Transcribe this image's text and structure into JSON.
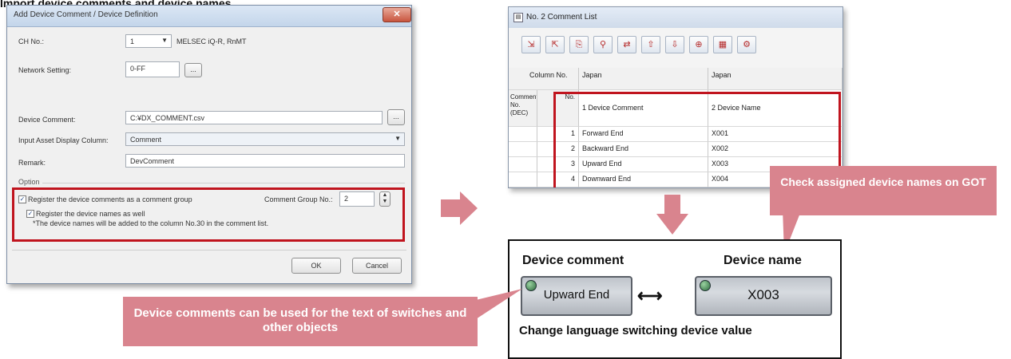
{
  "heading": "Import device comments and device names",
  "dialog": {
    "title": "Add Device Comment / Device Definition",
    "close_glyph": "✕",
    "ch_label": "CH No.:",
    "ch_value": "1",
    "ch_info": "MELSEC iQ-R, RnMT",
    "network_label": "Network Setting:",
    "network_value": "0-FF",
    "network_button": "...",
    "device_comment_label": "Device Comment:",
    "device_comment_value": "C:¥DX_COMMENT.csv",
    "device_comment_button": "...",
    "input_asset_label": "Input Asset Display Column:",
    "input_asset_value": "Comment",
    "remark_label": "Remark:",
    "remark_value": "DevComment",
    "option_label": "Option",
    "register_group_label": "Register the device comments as a comment group",
    "register_group_checked": true,
    "comment_group_label": "Comment Group No.:",
    "comment_group_value": "2",
    "register_names_label": "Register the device names as well",
    "register_names_checked": true,
    "names_note": "*The device names will be added to the column No.30 in the comment list.",
    "ok_label": "OK",
    "cancel_label": "Cancel"
  },
  "comment_list": {
    "title": "No. 2  Comment List",
    "toolbar_icons": [
      "import-icon",
      "export-icon",
      "copy-icon",
      "find-icon",
      "replace-icon",
      "up-icon",
      "down-icon",
      "zoom-icon",
      "table-icon",
      "settings-icon"
    ],
    "column_no_label": "Column No.",
    "col1_lang": "Japan",
    "col2_lang": "Japan",
    "comment_dec_label": "Comment No. (DEC)",
    "no_label": "No.",
    "col1_header": "1 Device Comment",
    "col2_header": "2 Device Name",
    "rows": [
      {
        "no": "1",
        "comment": "Forward End",
        "name": "X001"
      },
      {
        "no": "2",
        "comment": "Backward End",
        "name": "X002"
      },
      {
        "no": "3",
        "comment": "Upward End",
        "name": "X003"
      },
      {
        "no": "4",
        "comment": "Downward End",
        "name": "X004"
      }
    ]
  },
  "callout_check": "Check assigned device names on GOT",
  "callout_comments": "Device comments can be used for the text of switches and other objects",
  "got": {
    "comment_label": "Device comment",
    "name_label": "Device name",
    "switch_comment": "Upward End",
    "switch_name": "X003",
    "swap_glyph": "⟷",
    "footer": "Change language switching device value"
  },
  "colors": {
    "highlight": "#c0141e",
    "callout": "#d9848e"
  }
}
